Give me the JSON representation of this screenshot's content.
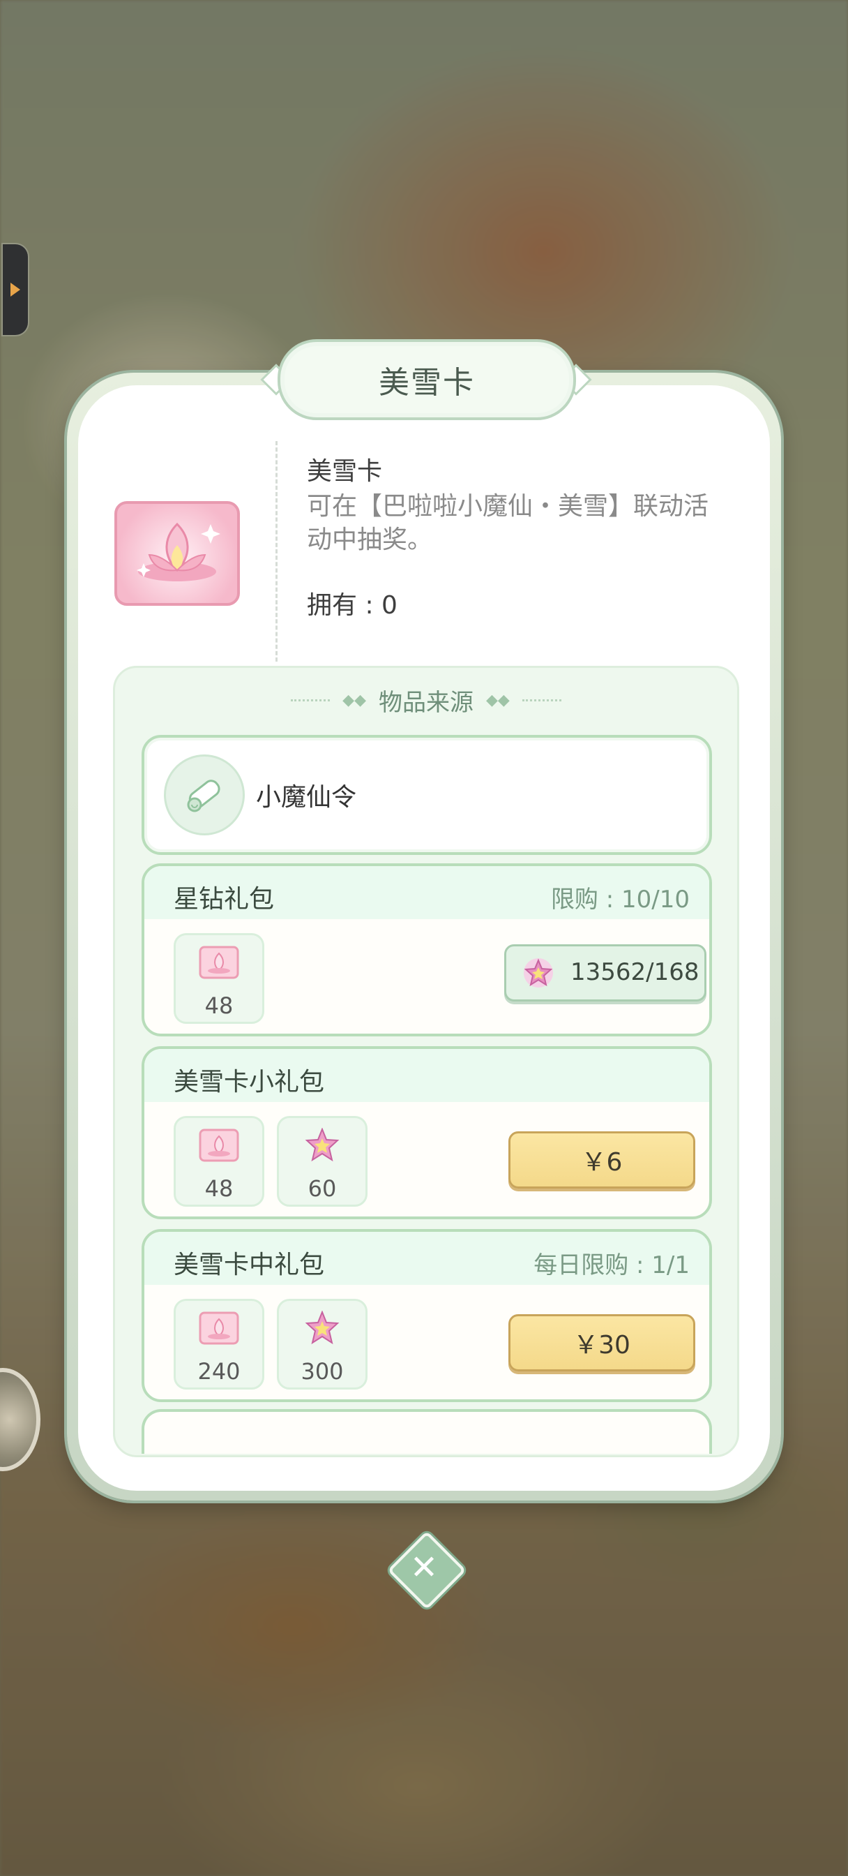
{
  "dialog": {
    "title": "美雪卡",
    "item_name": "美雪卡",
    "item_desc": "可在【巴啦啦小魔仙・美雪】联动活动中抽奖。",
    "own_text": "拥有 : 0",
    "icon": "lotus-card-icon"
  },
  "sources": {
    "header": "物品来源",
    "simple_source": {
      "label": "小魔仙令",
      "icon": "scroll-icon"
    },
    "packs": [
      {
        "name": "星钻礼包",
        "limit": "限购 : 10/10",
        "rewards": [
          {
            "icon": "lotus-card-icon",
            "count": "48"
          }
        ],
        "price": {
          "type": "star",
          "text": "13562/168",
          "icon": "star-diamond-icon"
        }
      },
      {
        "name": "美雪卡小礼包",
        "limit": "",
        "rewards": [
          {
            "icon": "lotus-card-icon",
            "count": "48"
          },
          {
            "icon": "star-diamond-icon",
            "count": "60"
          }
        ],
        "price": {
          "type": "cash",
          "text": "￥6"
        }
      },
      {
        "name": "美雪卡中礼包",
        "limit": "每日限购 : 1/1",
        "rewards": [
          {
            "icon": "lotus-card-icon",
            "count": "240"
          },
          {
            "icon": "star-diamond-icon",
            "count": "300"
          }
        ],
        "price": {
          "type": "cash",
          "text": "￥30"
        }
      }
    ]
  },
  "colors": {
    "accent_green": "#b8ddba",
    "price_gold": "#f4d98a",
    "card_pink": "#f6b9cb"
  },
  "close_icon": "close-icon"
}
